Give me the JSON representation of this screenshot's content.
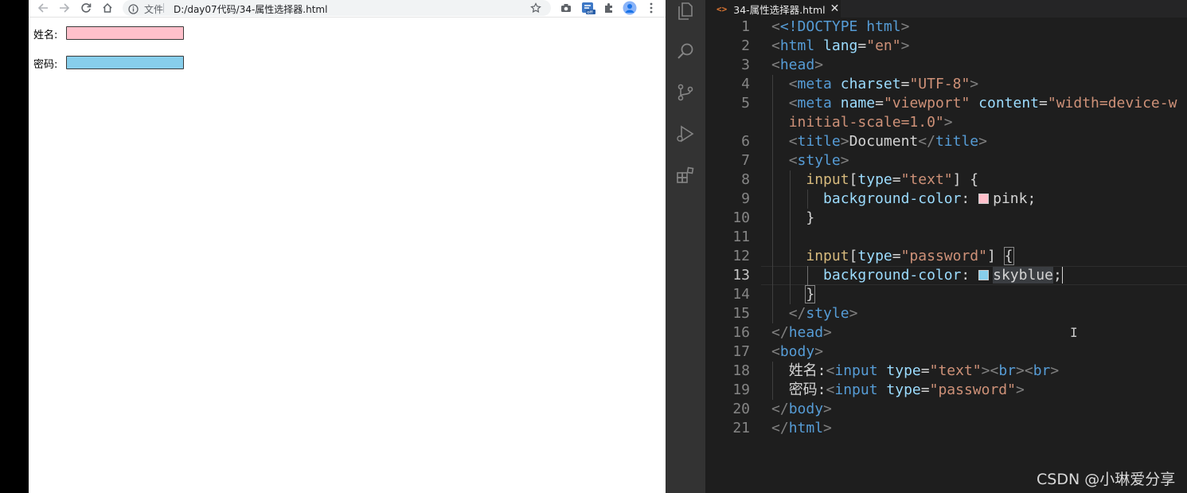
{
  "browser": {
    "url_scheme": "文件",
    "url": "D:/day07代码/34-属性选择器.html",
    "fields": [
      {
        "label": "姓名:",
        "type": "text",
        "background": "#ffc0cb"
      },
      {
        "label": "密码:",
        "type": "password",
        "background": "#87ceeb"
      }
    ]
  },
  "editor": {
    "tab_title": "34-属性选择器.html",
    "active_line": 13,
    "line_numbers": [
      "1",
      "2",
      "3",
      "4",
      "5",
      "",
      "6",
      "7",
      "8",
      "9",
      "10",
      "11",
      "12",
      "13",
      "14",
      "15",
      "16",
      "17",
      "18",
      "19",
      "20",
      "21"
    ],
    "code": {
      "l1_doctype": "<!DOCTYPE",
      "l1_html": "html",
      "l2_lang": "lang",
      "l2_en": "\"en\"",
      "l4_meta": "meta",
      "l4_charset": "charset",
      "l4_utf8": "\"UTF-8\"",
      "l5_name": "name",
      "l5_viewport": "\"viewport\"",
      "l5_content": "content",
      "l5_value": "\"width=device-w",
      "l5_wrap": "initial-scale=1.0\"",
      "l6_title": "title",
      "l6_text": "Document",
      "l7_style": "style",
      "l8_selector": "input",
      "l8_attr": "type",
      "l8_val": "\"text\"",
      "l9_prop": "background-color",
      "l9_value": "pink",
      "l12_selector": "input",
      "l12_attr": "type",
      "l12_val": "\"password\"",
      "l13_prop": "background-color",
      "l13_value": "skyblue",
      "l16_head": "head",
      "l17_body": "body",
      "l18_label": "姓名:",
      "l18_input": "input",
      "l18_type": "type",
      "l18_val": "\"text\"",
      "l18_br": "br",
      "l19_label": "密码:",
      "l19_type": "type",
      "l19_val": "\"password\"",
      "l21_html": "html"
    },
    "swatches": {
      "pink": "#ffc0cb",
      "skyblue": "#87ceeb"
    }
  },
  "watermark": "CSDN @小琳爱分享",
  "icons": [
    "back-arrow-icon",
    "forward-arrow-icon",
    "reload-icon",
    "home-icon",
    "info-icon",
    "star-icon",
    "camera-icon",
    "badge-off-icon",
    "extensions-icon",
    "profile-icon",
    "kebab-menu-icon",
    "explorer-icon",
    "search-icon",
    "source-control-icon",
    "run-debug-icon",
    "extensions-view-icon",
    "html-file-icon",
    "close-icon",
    "text-cursor-icon"
  ]
}
